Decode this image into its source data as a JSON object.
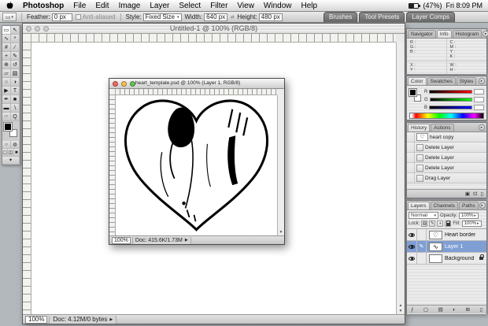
{
  "menu_bar": {
    "app_name": "Photoshop",
    "items": [
      "File",
      "Edit",
      "Image",
      "Layer",
      "Select",
      "Filter",
      "View",
      "Window",
      "Help"
    ],
    "battery": "(47%)",
    "clock": "Fri 8:09 PM"
  },
  "options_bar": {
    "feather_label": "Feather:",
    "feather_value": "0 px",
    "anti_aliased_label": "Anti-aliased",
    "style_label": "Style:",
    "style_value": "Fixed Size",
    "width_label": "Width:",
    "width_value": "640 px",
    "height_label": "Height:",
    "height_value": "480 px",
    "palette_well": [
      "Brushes",
      "Tool Presets",
      "Layer Comps"
    ]
  },
  "toolbox": {
    "tools": [
      {
        "name": "rectangular-marquee",
        "glyph": "▭"
      },
      {
        "name": "move",
        "glyph": "↖"
      },
      {
        "name": "lasso",
        "glyph": "∿"
      },
      {
        "name": "magic-wand",
        "glyph": "*"
      },
      {
        "name": "crop",
        "glyph": "#"
      },
      {
        "name": "slice",
        "glyph": "∕"
      },
      {
        "name": "healing-brush",
        "glyph": "+"
      },
      {
        "name": "brush",
        "glyph": "✎"
      },
      {
        "name": "clone-stamp",
        "glyph": "⊕"
      },
      {
        "name": "history-brush",
        "glyph": "↺"
      },
      {
        "name": "eraser",
        "glyph": "▱"
      },
      {
        "name": "gradient",
        "glyph": "▨"
      },
      {
        "name": "blur",
        "glyph": "○"
      },
      {
        "name": "dodge",
        "glyph": "◑"
      },
      {
        "name": "path-selection",
        "glyph": "▶"
      },
      {
        "name": "type",
        "glyph": "T"
      },
      {
        "name": "pen",
        "glyph": "✒"
      },
      {
        "name": "shape",
        "glyph": "■"
      },
      {
        "name": "notes",
        "glyph": "▬"
      },
      {
        "name": "eyedropper",
        "glyph": "∖"
      },
      {
        "name": "hand",
        "glyph": "☞"
      },
      {
        "name": "zoom",
        "glyph": "Q"
      }
    ],
    "extras": [
      {
        "name": "standard-mode",
        "glyph": "○"
      },
      {
        "name": "quick-mask-mode",
        "glyph": "◍"
      },
      {
        "name": "standard-screen-mode",
        "glyph": "▢"
      },
      {
        "name": "full-screen-menubar-mode",
        "glyph": "◫"
      },
      {
        "name": "full-screen-mode",
        "glyph": "■"
      },
      {
        "name": "imageready",
        "glyph": "✦"
      }
    ]
  },
  "main_window": {
    "title": "Untitled-1 @ 100% (RGB/8)",
    "zoom": "100%",
    "doc_info": "Doc: 4.12M/0 bytes"
  },
  "float_window": {
    "title": "heart_template.psd @ 100% (Layer 1, RGB/8)",
    "zoom": "100%",
    "doc_info": "Doc: 415.6K/1.73M"
  },
  "navigator_palette": {
    "tabs": [
      "Navigator",
      "Info",
      "Histogram"
    ],
    "info": {
      "rgb_labels": [
        "R :",
        "G :",
        "B :"
      ],
      "cmyk_labels": [
        "C :",
        "M :",
        "Y :",
        "K :"
      ],
      "xy_labels": [
        "X :",
        "Y :"
      ],
      "wh_labels": [
        "W :",
        "H :"
      ]
    }
  },
  "color_palette": {
    "tabs": [
      "Color",
      "Swatches",
      "Styles"
    ],
    "channels": [
      "R",
      "G",
      "B"
    ]
  },
  "history_palette": {
    "tabs": [
      "History",
      "Actions"
    ],
    "snapshot": "heart copy",
    "states": [
      "Delete Layer",
      "Delete Layer",
      "Delete Layer",
      "Drag Layer"
    ],
    "bottom_icons": [
      "▣",
      "⊡",
      "▯"
    ]
  },
  "layers_palette": {
    "tabs": [
      "Layers",
      "Channels",
      "Paths"
    ],
    "blend_mode": "Normal",
    "opacity_label": "Opacity:",
    "opacity_value": "100%",
    "lock_label": "Lock:",
    "lock_icons": [
      "▨",
      "✎",
      "+"
    ],
    "fill_label": "Fill:",
    "fill_value": "100%",
    "layers": [
      {
        "name": "Heart border"
      },
      {
        "name": "Layer 1"
      },
      {
        "name": "Background"
      }
    ],
    "bottom_icons": [
      "ƒ",
      "▢",
      "▤",
      "◐",
      "⊞",
      "▯"
    ]
  },
  "icons": {
    "chevron_down": "▾",
    "chevron_right": "▸",
    "play": "▶",
    "swap": "⇄",
    "palette_menu": "▸",
    "up_arrow": "▲",
    "down_arrow": "▼",
    "crosshair": "+",
    "size_box": "⊡",
    "heart_thumb": "♡",
    "sketch_thumb": "∿"
  },
  "colors": {
    "selection_blue": "#7f9fd4",
    "close_button": "#ee6a5f",
    "minimize_button": "#f6bf4f",
    "zoom_button": "#62c354"
  }
}
